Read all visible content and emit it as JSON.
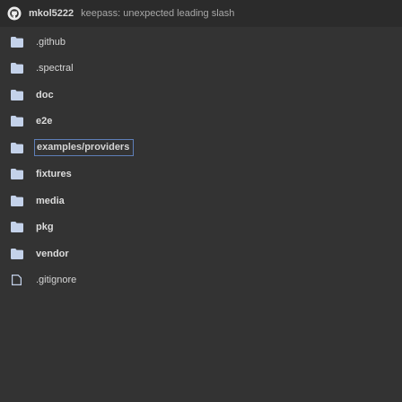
{
  "header": {
    "author": "mkol5222",
    "commit_message": "keepass: unexpected leading slash"
  },
  "files": [
    {
      "name": ".github",
      "type": "folder",
      "icon": "folder-icon"
    },
    {
      "name": ".spectral",
      "type": "folder",
      "icon": "folder-icon"
    },
    {
      "name": "doc",
      "type": "folder",
      "icon": "folder-icon"
    },
    {
      "name": "e2e",
      "type": "folder",
      "icon": "folder-icon"
    },
    {
      "name": "examples/providers",
      "type": "folder",
      "icon": "folder-icon",
      "selected": true
    },
    {
      "name": "fixtures",
      "type": "folder",
      "icon": "folder-icon"
    },
    {
      "name": "media",
      "type": "folder",
      "icon": "folder-icon"
    },
    {
      "name": "pkg",
      "type": "folder",
      "icon": "folder-icon"
    },
    {
      "name": "vendor",
      "type": "folder",
      "icon": "folder-icon"
    },
    {
      "name": ".gitignore",
      "type": "file",
      "icon": "file-icon"
    }
  ],
  "colors": {
    "background": "#333333",
    "header_background": "#2b2b2b",
    "icon": "#c4d2ea",
    "focus_outline": "#5e7fb8"
  }
}
